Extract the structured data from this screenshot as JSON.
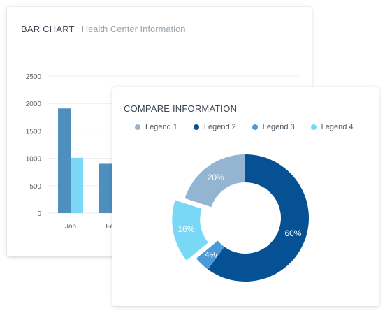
{
  "bar_card": {
    "title": "BAR CHART",
    "subtitle": "Health Center Information"
  },
  "pie_card": {
    "title": "COMPARE INFORMATION"
  },
  "chart_data": [
    {
      "type": "bar",
      "title": "BAR CHART",
      "subtitle": "Health Center Information",
      "categories": [
        "Jan",
        "Feb"
      ],
      "series": [
        {
          "values": [
            1910,
            900
          ],
          "color": "#4f8fbd"
        },
        {
          "values": [
            1010,
            null
          ],
          "color": "#7ad8f6"
        }
      ],
      "ylim": [
        0,
        2500
      ],
      "yticks": [
        "0",
        "500",
        "1000",
        "1500",
        "2000",
        "2500"
      ],
      "grid": true
    },
    {
      "type": "pie",
      "title": "COMPARE INFORMATION",
      "legend_position": "top",
      "slices": [
        {
          "name": "Legend 1",
          "value": 20,
          "label": "20%",
          "color": "#94b5d2"
        },
        {
          "name": "Legend 2",
          "value": 60,
          "label": "60%",
          "color": "#065194"
        },
        {
          "name": "Legend 3",
          "value": 4,
          "label": "4%",
          "color": "#4d9ad8"
        },
        {
          "name": "Legend 4",
          "value": 16,
          "label": "16%",
          "color": "#78d8f6",
          "exploded": true
        }
      ]
    }
  ]
}
